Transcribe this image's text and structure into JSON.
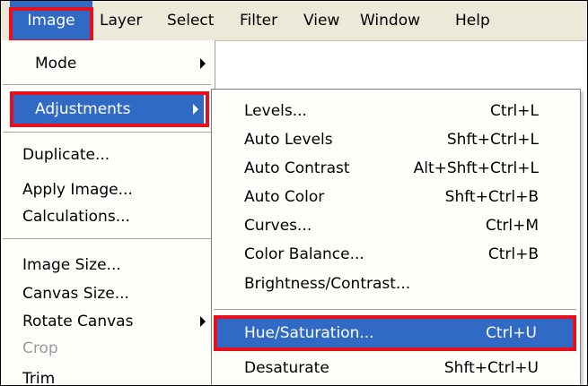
{
  "menubar": {
    "items": [
      "Image",
      "Layer",
      "Select",
      "Filter",
      "View",
      "Window",
      "Help"
    ],
    "active": "Image"
  },
  "image_menu": {
    "mode": "Mode",
    "adjustments": "Adjustments",
    "duplicate": "Duplicate...",
    "apply_image": "Apply Image...",
    "calculations": "Calculations...",
    "image_size": "Image Size...",
    "canvas_size": "Canvas Size...",
    "rotate_canvas": "Rotate Canvas",
    "crop": "Crop",
    "trim": "Trim"
  },
  "adjustments_menu": {
    "levels": {
      "label": "Levels...",
      "shortcut": "Ctrl+L"
    },
    "auto_levels": {
      "label": "Auto Levels",
      "shortcut": "Shft+Ctrl+L"
    },
    "auto_contrast": {
      "label": "Auto Contrast",
      "shortcut": "Alt+Shft+Ctrl+L"
    },
    "auto_color": {
      "label": "Auto Color",
      "shortcut": "Shft+Ctrl+B"
    },
    "curves": {
      "label": "Curves...",
      "shortcut": "Ctrl+M"
    },
    "color_balance": {
      "label": "Color Balance...",
      "shortcut": "Ctrl+B"
    },
    "brightness_contrast": {
      "label": "Brightness/Contrast...",
      "shortcut": ""
    },
    "hue_saturation": {
      "label": "Hue/Saturation...",
      "shortcut": "Ctrl+U"
    },
    "desaturate": {
      "label": "Desaturate",
      "shortcut": "Shft+Ctrl+U"
    }
  },
  "colors": {
    "highlight": "#316ac5",
    "callout": "#e8101c",
    "menubar_bg": "#ece9d8"
  }
}
